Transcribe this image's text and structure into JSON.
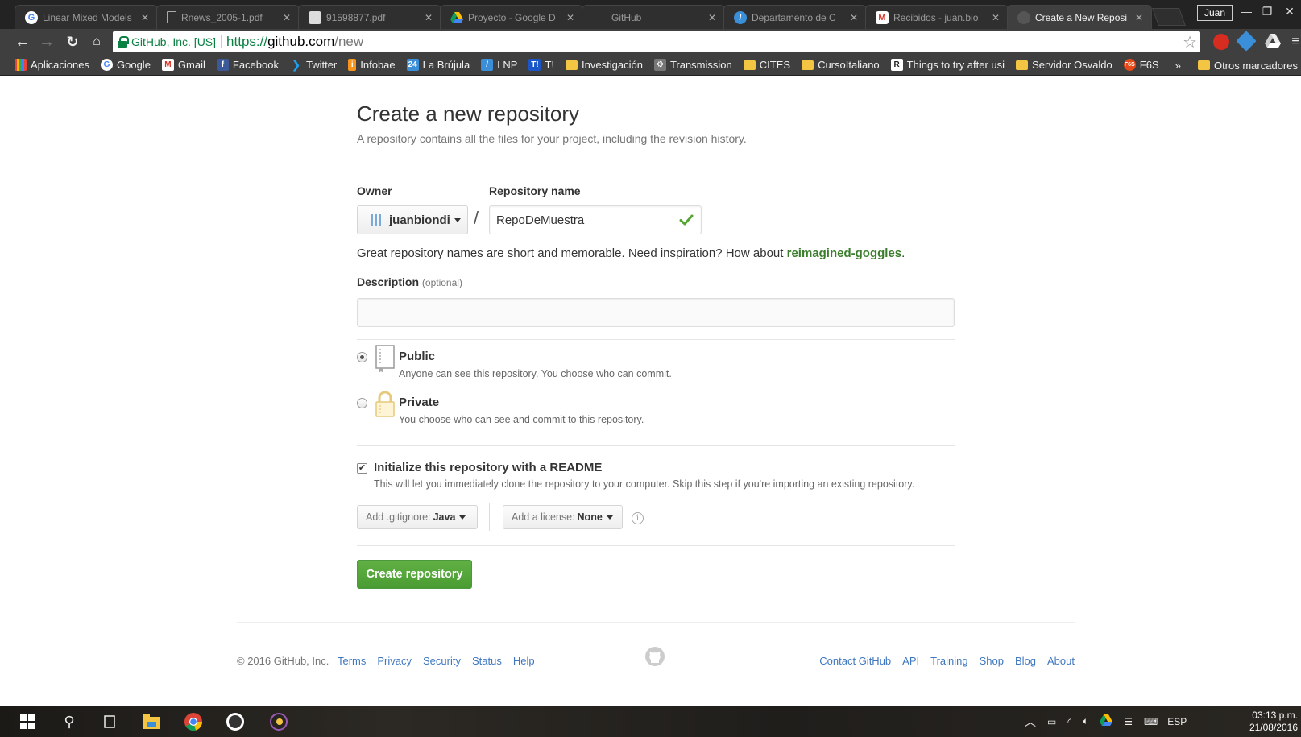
{
  "browser": {
    "tabs": [
      {
        "title": "Linear Mixed Models",
        "icon": "google-icon",
        "active": false
      },
      {
        "title": "Rnews_2005-1.pdf",
        "icon": "document-icon",
        "active": false
      },
      {
        "title": "91598877.pdf",
        "icon": "pdf-icon",
        "active": false
      },
      {
        "title": "Proyecto - Google D",
        "icon": "google-drive-icon",
        "active": false
      },
      {
        "title": "GitHub",
        "icon": "",
        "active": false
      },
      {
        "title": "Departamento de C",
        "icon": "compass-icon",
        "active": false
      },
      {
        "title": "Recibidos - juan.bio",
        "icon": "gmail-icon",
        "active": false
      },
      {
        "title": "Create a New Reposi",
        "icon": "github-icon",
        "active": true
      }
    ],
    "user": "Juan",
    "secure_label": "GitHub, Inc. [US]",
    "url_scheme": "https://",
    "url_host": "github.com",
    "url_path": "/new"
  },
  "bookmarks": [
    {
      "label": "Aplicaciones",
      "icon": "apps-icon"
    },
    {
      "label": "Google",
      "icon": "google-icon"
    },
    {
      "label": "Gmail",
      "icon": "gmail-icon"
    },
    {
      "label": "Facebook",
      "icon": "facebook-icon"
    },
    {
      "label": "Twitter",
      "icon": "twitter-icon"
    },
    {
      "label": "Infobae",
      "icon": "infobae-icon"
    },
    {
      "label": "La Brújula",
      "icon": "calendar-icon"
    },
    {
      "label": "LNP",
      "icon": "lnp-icon"
    },
    {
      "label": "T!",
      "icon": "t-icon"
    },
    {
      "label": "Investigación",
      "icon": "folder-icon"
    },
    {
      "label": "Transmission",
      "icon": "transmission-icon"
    },
    {
      "label": "CITES",
      "icon": "folder-icon"
    },
    {
      "label": "CursoItaliano",
      "icon": "folder-icon"
    },
    {
      "label": "Things to try after usi",
      "icon": "r-icon"
    },
    {
      "label": "Servidor Osvaldo",
      "icon": "folder-icon"
    },
    {
      "label": "F6S",
      "icon": "f6s-icon"
    }
  ],
  "bookmarks_overflow": "»",
  "bookmarks_other": "Otros marcadores",
  "page": {
    "title": "Create a new repository",
    "subtitle": "A repository contains all the files for your project, including the revision history.",
    "owner_label": "Owner",
    "owner_value": "juanbiondi",
    "repo_name_label": "Repository name",
    "repo_name_value": "RepoDeMuestra",
    "slash": "/",
    "hint_text": "Great repository names are short and memorable. Need inspiration? How about ",
    "hint_suggestion": "reimagined-goggles",
    "hint_end": ".",
    "description_label": "Description",
    "description_optional": "(optional)",
    "description_value": "",
    "public_title": "Public",
    "public_note": "Anyone can see this repository. You choose who can commit.",
    "private_title": "Private",
    "private_note": "You choose who can see and commit to this repository.",
    "visibility_selected": "Public",
    "readme_checked": true,
    "readme_title": "Initialize this repository with a README",
    "readme_note": "This will let you immediately clone the repository to your computer. Skip this step if you're importing an existing repository.",
    "gitignore_label": "Add .gitignore:",
    "gitignore_value": "Java",
    "license_label": "Add a license:",
    "license_value": "None",
    "info_symbol": "i",
    "create_button": "Create repository"
  },
  "footer": {
    "copyright": "© 2016 GitHub, Inc.",
    "left_links": [
      "Terms",
      "Privacy",
      "Security",
      "Status",
      "Help"
    ],
    "right_links": [
      "Contact GitHub",
      "API",
      "Training",
      "Shop",
      "Blog",
      "About"
    ]
  },
  "taskbar": {
    "language": "ESP",
    "time": "03:13 p.m.",
    "date": "21/08/2016"
  },
  "colors": {
    "accent_green": "#3a7e2b",
    "button_green": "#55a532",
    "link_blue": "#4078c0"
  }
}
